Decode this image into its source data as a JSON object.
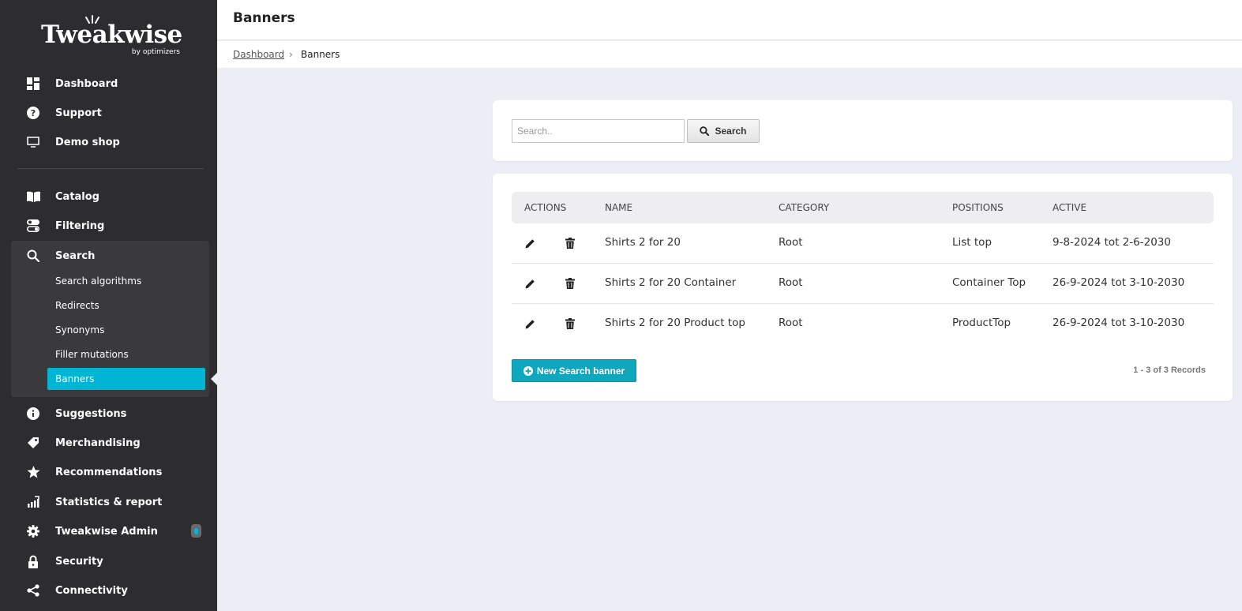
{
  "brand": {
    "name": "Tweakwise",
    "tagline": "by optimizers",
    "accent": "#00b4d3"
  },
  "sidebar": {
    "items": [
      {
        "label": "Dashboard",
        "icon": "grid-icon"
      },
      {
        "label": "Support",
        "icon": "question-circle-icon"
      },
      {
        "label": "Demo shop",
        "icon": "monitor-icon"
      },
      {
        "label": "Catalog",
        "icon": "book-icon"
      },
      {
        "label": "Filtering",
        "icon": "toggles-icon"
      },
      {
        "label": "Search",
        "icon": "search-icon"
      },
      {
        "label": "Suggestions",
        "icon": "info-circle-icon"
      },
      {
        "label": "Merchandising",
        "icon": "tag-icon"
      },
      {
        "label": "Recommendations",
        "icon": "star-icon"
      },
      {
        "label": "Statistics & report",
        "icon": "bar-chart-icon"
      },
      {
        "label": "Tweakwise Admin",
        "icon": "gear-icon"
      },
      {
        "label": "Security",
        "icon": "lock-icon"
      },
      {
        "label": "Connectivity",
        "icon": "share-icon"
      }
    ],
    "search_sub": [
      {
        "label": "Search algorithms"
      },
      {
        "label": "Redirects"
      },
      {
        "label": "Synonyms"
      },
      {
        "label": "Filler mutations"
      },
      {
        "label": "Banners",
        "active": true
      }
    ]
  },
  "header": {
    "title": "Banners"
  },
  "breadcrumb": {
    "parent": "Dashboard",
    "separator": "›",
    "current": "Banners"
  },
  "search": {
    "placeholder": "Search..",
    "value": "",
    "button_label": "Search"
  },
  "table": {
    "columns": [
      "ACTIONS",
      "NAME",
      "CATEGORY",
      "POSITIONS",
      "ACTIVE"
    ],
    "rows": [
      {
        "name": "Shirts 2 for 20",
        "category": "Root",
        "positions": "List top",
        "active": "9-8-2024 tot 2-6-2030"
      },
      {
        "name": "Shirts 2 for 20 Container",
        "category": "Root",
        "positions": "Container Top",
        "active": "26-9-2024 tot 3-10-2030"
      },
      {
        "name": "Shirts 2 for 20 Product top",
        "category": "Root",
        "positions": "ProductTop",
        "active": "26-9-2024 tot 3-10-2030"
      }
    ]
  },
  "footer": {
    "new_button": "New Search banner",
    "records": "1 - 3 of 3 Records"
  }
}
